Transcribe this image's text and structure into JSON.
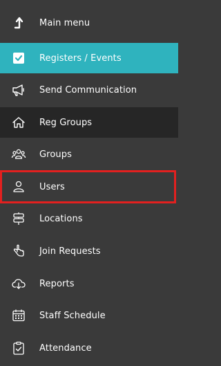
{
  "menu": {
    "items": [
      {
        "label": "Main menu",
        "icon": "arrow-up-icon"
      },
      {
        "label": "Registers / Events",
        "icon": "checkbox-icon"
      },
      {
        "label": "Send Communication",
        "icon": "megaphone-icon"
      },
      {
        "label": "Reg Groups",
        "icon": "home-icon"
      },
      {
        "label": "Groups",
        "icon": "people-icon"
      },
      {
        "label": "Users",
        "icon": "user-icon"
      },
      {
        "label": "Locations",
        "icon": "signpost-icon"
      },
      {
        "label": "Join Requests",
        "icon": "hand-icon"
      },
      {
        "label": "Reports",
        "icon": "cloud-download-icon"
      },
      {
        "label": "Staff Schedule",
        "icon": "calendar-icon"
      },
      {
        "label": "Attendance",
        "icon": "clipboard-check-icon"
      }
    ]
  },
  "colors": {
    "background": "#3a3a3a",
    "active": "#2fb3be",
    "hover": "#262626",
    "highlight_border": "#e3201f",
    "text": "#ffffff"
  }
}
